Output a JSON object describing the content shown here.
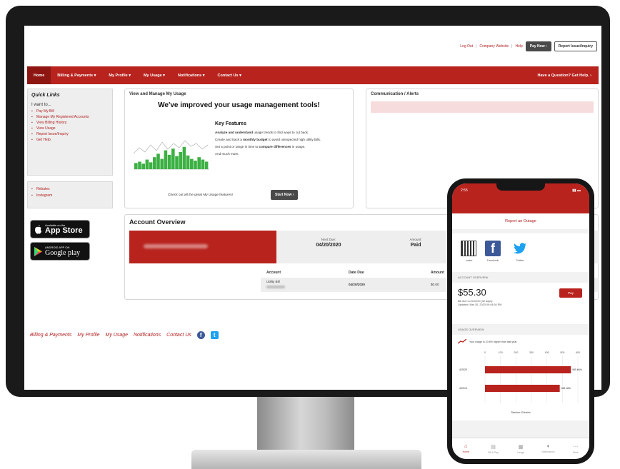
{
  "header": {
    "log_out": "Log Out",
    "company_website": "Company Website",
    "help": "Help",
    "pay_now": "Pay Now ›",
    "report_issue": "Report Issue/Inquiry"
  },
  "nav": {
    "items": [
      {
        "label": "Home"
      },
      {
        "label": "Billing & Payments ▾"
      },
      {
        "label": "My Profile ▾"
      },
      {
        "label": "My Usage ▾"
      },
      {
        "label": "Notifications ▾"
      },
      {
        "label": "Contact Us ▾"
      }
    ],
    "right": "Have a Question? Get Help. ›"
  },
  "quick_links": {
    "title": "Quick Links",
    "subtitle": "I want to...",
    "items": [
      "Pay My Bill",
      "Manage My Registered Accounts",
      "View Billing History",
      "View Usage",
      "Report Issue/Inquiry",
      "Get Help"
    ],
    "extra": [
      "Rebates",
      "Instagram"
    ]
  },
  "app_store": {
    "small": "Available on the",
    "big": "App Store"
  },
  "google_play": {
    "small": "ANDROID APP ON",
    "big": "Google play"
  },
  "usage_card": {
    "title": "View and Manage My Usage",
    "headline": "We've improved your usage management tools!",
    "features_title": "Key Features",
    "f1_bold": "Analyze and understand",
    "f1_rest": " usage trends to find ways to cut back.",
    "f2_pre": "Create and track a ",
    "f2_bold": "monthly budget",
    "f2_post": " to avoid unexpected high utility bills.",
    "f3_pre": "Set a point or range in time to ",
    "f3_bold": "compare differences",
    "f3_post": " in usage.",
    "f4": "And much more.",
    "check": "Check out all the great My Usage features!",
    "start": "Start Now ›",
    "chart_levels": [
      0.18,
      0.22,
      0.16,
      0.28,
      0.2,
      0.35,
      0.45,
      0.3,
      0.55,
      0.42,
      0.6,
      0.38,
      0.5,
      0.65,
      0.4,
      0.3,
      0.25,
      0.35,
      0.28,
      0.22
    ]
  },
  "alerts": {
    "title": "Communication / Alerts"
  },
  "account": {
    "title": "Account Overview",
    "next_due_label": "Next Due:",
    "next_due": "04/20/2020",
    "amount_label": "Amount:",
    "amount": "Paid",
    "col_account": "Account",
    "col_date_due": "Date Due",
    "col_amount": "Amount",
    "row_account": "Utility Bill",
    "row_date": "04/20/2020",
    "row_amount": "$0.00"
  },
  "footer": {
    "links": [
      "Billing & Payments",
      "My Profile",
      "My Usage",
      "Notifications",
      "Contact Us"
    ]
  },
  "phone": {
    "time": "2:55",
    "report": "Report an Outage",
    "social": [
      "sales",
      "Facebook",
      "Twitter"
    ],
    "account_label": "ACCOUNT OVERVIEW",
    "amount": "$55.30",
    "due_line": "Bill due on 5/12/20 (32 days).",
    "updated": "Updated: Mar 30, 2020 09:44:54 PM",
    "pay": "Pay",
    "usage_label": "USAGE OVERVIEW",
    "usage_note": "Your usage is 10.6% higher than last year.",
    "axis_ticks": [
      "0",
      "100",
      "200",
      "300",
      "400",
      "500",
      "600"
    ],
    "bar1_label": "4/2020",
    "bar1_value_label": "555 kWh",
    "bar1_value": 555,
    "bar2_label": "4/2019",
    "bar2_value_label": "483 kWh",
    "bar2_value": 483,
    "axis_max": 600,
    "legend": "Service: Electric",
    "tabs": [
      "Home",
      "Bill & Pay",
      "Usage",
      "Notifications",
      "More"
    ]
  }
}
